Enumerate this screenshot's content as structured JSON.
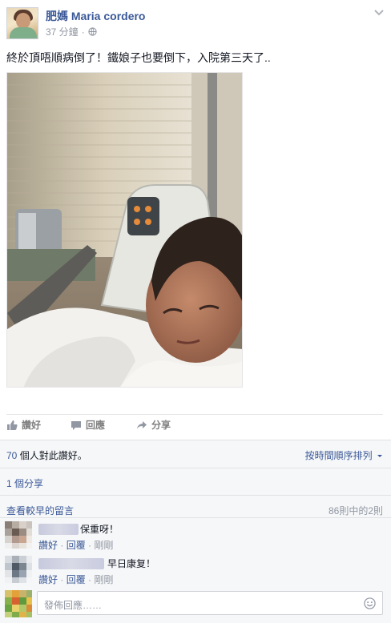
{
  "post": {
    "author": "肥媽 Maria cordero",
    "time": "37 分鐘",
    "dot": "·",
    "text": "終於頂唔順病倒了！鐵娘子也要倒下，入院第三天了.."
  },
  "actions": {
    "like": "讚好",
    "comment": "回應",
    "share": "分享"
  },
  "stats": {
    "likes_count": "70",
    "likes_text": " 個人對此讚好。",
    "sort_label": "按時間順序排列",
    "shares": "1 個分享",
    "view_older": "查看較早的留言",
    "page_info": "86則中的2則"
  },
  "comments": [
    {
      "text": "保重呀！",
      "like": "讚好",
      "reply": "回覆",
      "time": "剛剛",
      "dot": " · "
    },
    {
      "text": "早日康复！",
      "like": "讚好",
      "reply": "回覆",
      "time": "剛剛",
      "dot": " · "
    }
  ],
  "reply": {
    "placeholder": "發佈回應……"
  },
  "colors": {
    "link": "#3b5998",
    "muted": "#9197a3",
    "ufi_bg": "#f6f7f8"
  },
  "icons": {
    "globe": "globe-icon",
    "chevron": "chevron-down-icon",
    "like": "thumbs-up-icon",
    "comment": "speech-bubble-icon",
    "share": "share-arrow-icon",
    "smile": "smile-icon"
  }
}
